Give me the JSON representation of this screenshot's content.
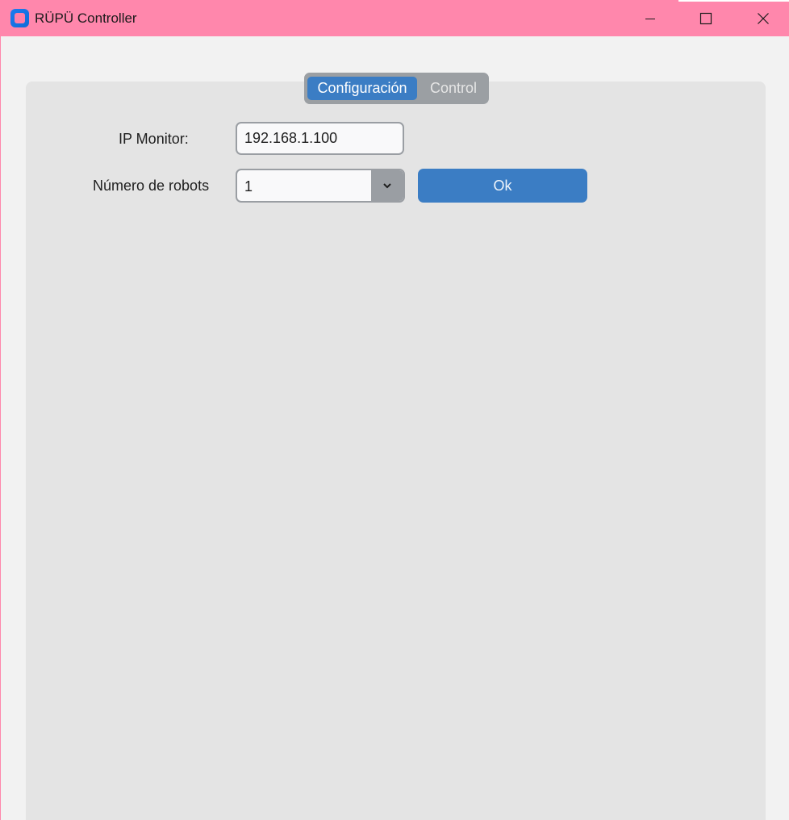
{
  "window": {
    "title": "RÜPÜ Controller",
    "title_bar_color": "#ff87ac",
    "controls": [
      "minimize-icon",
      "maximize-icon",
      "close-icon"
    ]
  },
  "tabs": [
    {
      "label": "Configuración",
      "selected": true
    },
    {
      "label": "Control",
      "selected": false
    }
  ],
  "form": {
    "ip_label": "IP Monitor:",
    "ip_value": "192.168.1.100",
    "robots_label": "Número de robots",
    "robots_value": "1",
    "ok_label": "Ok"
  },
  "colors": {
    "accent": "#3b7dc4",
    "panel": "#e4e4e4",
    "tab_bg": "#9b9fa3"
  }
}
